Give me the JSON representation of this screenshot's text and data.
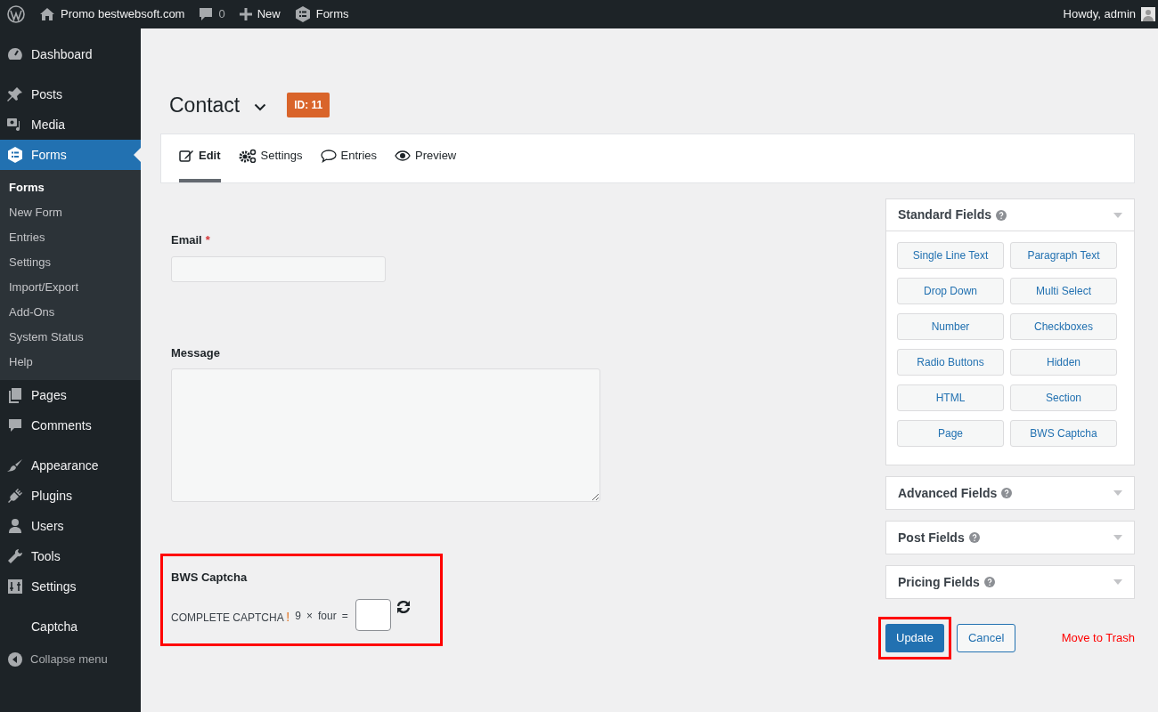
{
  "admin_bar": {
    "site": "Promo bestwebsoft.com",
    "comments": "0",
    "new": "New",
    "forms": "Forms",
    "greeting": "Howdy, admin"
  },
  "sidebar": {
    "items": [
      {
        "label": "Dashboard",
        "selected": false
      },
      {
        "label": "Posts",
        "selected": false
      },
      {
        "label": "Media",
        "selected": false
      },
      {
        "label": "Forms",
        "selected": true,
        "children": [
          {
            "label": "Forms",
            "selected": true
          },
          {
            "label": "New Form",
            "selected": false
          },
          {
            "label": "Entries",
            "selected": false
          },
          {
            "label": "Settings",
            "selected": false
          },
          {
            "label": "Import/Export",
            "selected": false
          },
          {
            "label": "Add-Ons",
            "selected": false
          },
          {
            "label": "System Status",
            "selected": false
          },
          {
            "label": "Help",
            "selected": false
          }
        ]
      },
      {
        "label": "Pages",
        "selected": false
      },
      {
        "label": "Comments",
        "selected": false
      },
      {
        "label": "Appearance",
        "selected": false
      },
      {
        "label": "Plugins",
        "selected": false
      },
      {
        "label": "Users",
        "selected": false
      },
      {
        "label": "Tools",
        "selected": false
      },
      {
        "label": "Settings",
        "selected": false
      },
      {
        "label": "Captcha",
        "selected": false
      }
    ],
    "collapse": "Collapse menu"
  },
  "form_title": "Contact",
  "form_id": "ID: 11",
  "tabs": [
    {
      "label": "Edit",
      "selected": true
    },
    {
      "label": "Settings",
      "selected": false
    },
    {
      "label": "Entries",
      "selected": false
    },
    {
      "label": "Preview",
      "selected": false
    }
  ],
  "fields": [
    {
      "kind": "text",
      "label": "Email",
      "required": true,
      "required_mark": "*"
    },
    {
      "kind": "textarea",
      "label": "Message",
      "required": false
    }
  ],
  "captcha": {
    "label": "BWS Captcha",
    "prompt": "COMPLETE CAPTCHA",
    "mark": "!",
    "expression": [
      "9",
      "×",
      "four",
      "="
    ]
  },
  "field_groups": [
    {
      "title": "Standard Fields",
      "expanded": true,
      "buttons": [
        "Single Line Text",
        "Paragraph Text",
        "Drop Down",
        "Multi Select",
        "Number",
        "Checkboxes",
        "Radio Buttons",
        "Hidden",
        "HTML",
        "Section",
        "Page",
        "BWS Captcha"
      ]
    },
    {
      "title": "Advanced Fields",
      "expanded": false
    },
    {
      "title": "Post Fields",
      "expanded": false
    },
    {
      "title": "Pricing Fields",
      "expanded": false
    }
  ],
  "actions": {
    "update": "Update",
    "cancel": "Cancel",
    "trash": "Move to Trash"
  }
}
